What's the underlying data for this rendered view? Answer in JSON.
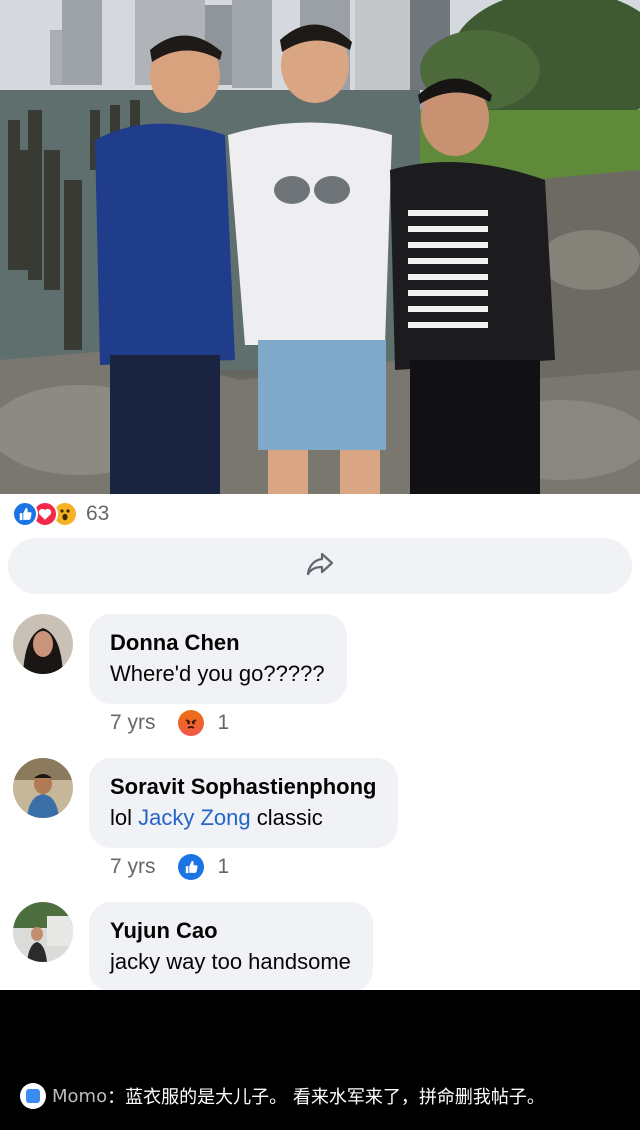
{
  "post": {
    "reactions": {
      "icons": [
        "like-icon",
        "love-icon",
        "wow-icon"
      ],
      "count": "63"
    },
    "share_icon": "share-icon"
  },
  "comments": [
    {
      "author": "Donna Chen",
      "text": "Where'd you go?????",
      "time": "7 yrs",
      "reaction_icon": "angry-icon",
      "reaction_count": "1"
    },
    {
      "author": "Soravit Sophastienphong",
      "text_prefix": "lol ",
      "mention": "Jacky Zong",
      "text_suffix": " classic",
      "time": "7 yrs",
      "reaction_icon": "like-icon",
      "reaction_count": "1"
    },
    {
      "author": "Yujun Cao",
      "text": "jacky way too handsome"
    }
  ],
  "overlay_caption": {
    "user": "Momo",
    "separator": "：",
    "message": "蓝衣服的是大儿子。 看来水军来了，拼命删我帖子。"
  },
  "colors": {
    "like_blue": "#1b74e4",
    "love_red": "#f0284a",
    "wow_yellow": "#f7b125",
    "mention_blue": "#2564c9",
    "bubble_bg": "#f0f2f5"
  }
}
